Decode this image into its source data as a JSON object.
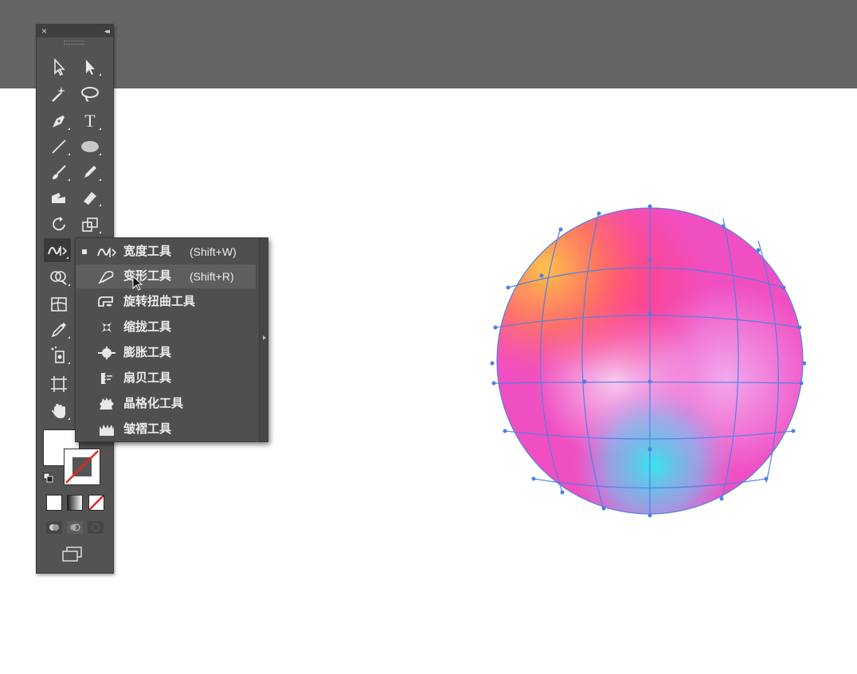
{
  "toolbox": {
    "close_glyph": "×",
    "collapse_glyph": "◂◂",
    "tools": [
      {
        "name": "selection-tool",
        "icon": "arrow-icon"
      },
      {
        "name": "direct-selection-tool",
        "icon": "direct-arrow-icon"
      },
      {
        "name": "magic-wand-tool",
        "icon": "magic-wand-icon"
      },
      {
        "name": "lasso-tool",
        "icon": "lasso-icon"
      },
      {
        "name": "pen-tool",
        "icon": "pen-icon"
      },
      {
        "name": "type-tool",
        "icon": "type-icon"
      },
      {
        "name": "line-segment-tool",
        "icon": "line-icon"
      },
      {
        "name": "ellipse-tool",
        "icon": "ellipse-icon"
      },
      {
        "name": "paintbrush-tool",
        "icon": "brush-icon"
      },
      {
        "name": "pencil-tool",
        "icon": "pencil-icon"
      },
      {
        "name": "blob-brush-tool",
        "icon": "blob-brush-icon"
      },
      {
        "name": "eraser-tool",
        "icon": "eraser-icon"
      },
      {
        "name": "rotate-tool",
        "icon": "rotate-icon"
      },
      {
        "name": "scale-tool",
        "icon": "scale-icon"
      },
      {
        "name": "width-tool",
        "icon": "width-icon"
      },
      {
        "name": "shape-builder-tool",
        "icon": "shape-builder-icon"
      },
      {
        "name": "mesh-tool",
        "icon": "mesh-icon"
      },
      {
        "name": "eyedropper-tool",
        "icon": "eyedropper-icon"
      },
      {
        "name": "symbol-sprayer-tool",
        "icon": "symbol-sprayer-icon"
      },
      {
        "name": "artboard-tool",
        "icon": "artboard-icon"
      },
      {
        "name": "hand-tool",
        "icon": "hand-icon"
      }
    ],
    "type_glyph": "T"
  },
  "flyout": {
    "items": [
      {
        "label": "宽度工具",
        "shortcut": "(Shift+W)",
        "icon": "width-icon",
        "selected": true
      },
      {
        "label": "变形工具",
        "shortcut": "(Shift+R)",
        "icon": "warp-icon",
        "hover": true
      },
      {
        "label": "旋转扭曲工具",
        "shortcut": "",
        "icon": "twirl-icon"
      },
      {
        "label": "缩拢工具",
        "shortcut": "",
        "icon": "pucker-icon"
      },
      {
        "label": "膨胀工具",
        "shortcut": "",
        "icon": "bloat-icon"
      },
      {
        "label": "扇贝工具",
        "shortcut": "",
        "icon": "scallop-icon"
      },
      {
        "label": "晶格化工具",
        "shortcut": "",
        "icon": "crystallize-icon"
      },
      {
        "label": "皱褶工具",
        "shortcut": "",
        "icon": "wrinkle-icon"
      }
    ]
  },
  "colors": {
    "ui_dark": "#535353",
    "canvas_top": "#656565",
    "mesh_stroke": "#4f7fe0",
    "sphere_pink": "#f253c4",
    "sphere_cyan": "#3fe0ea",
    "sphere_orange": "#ffb347"
  }
}
